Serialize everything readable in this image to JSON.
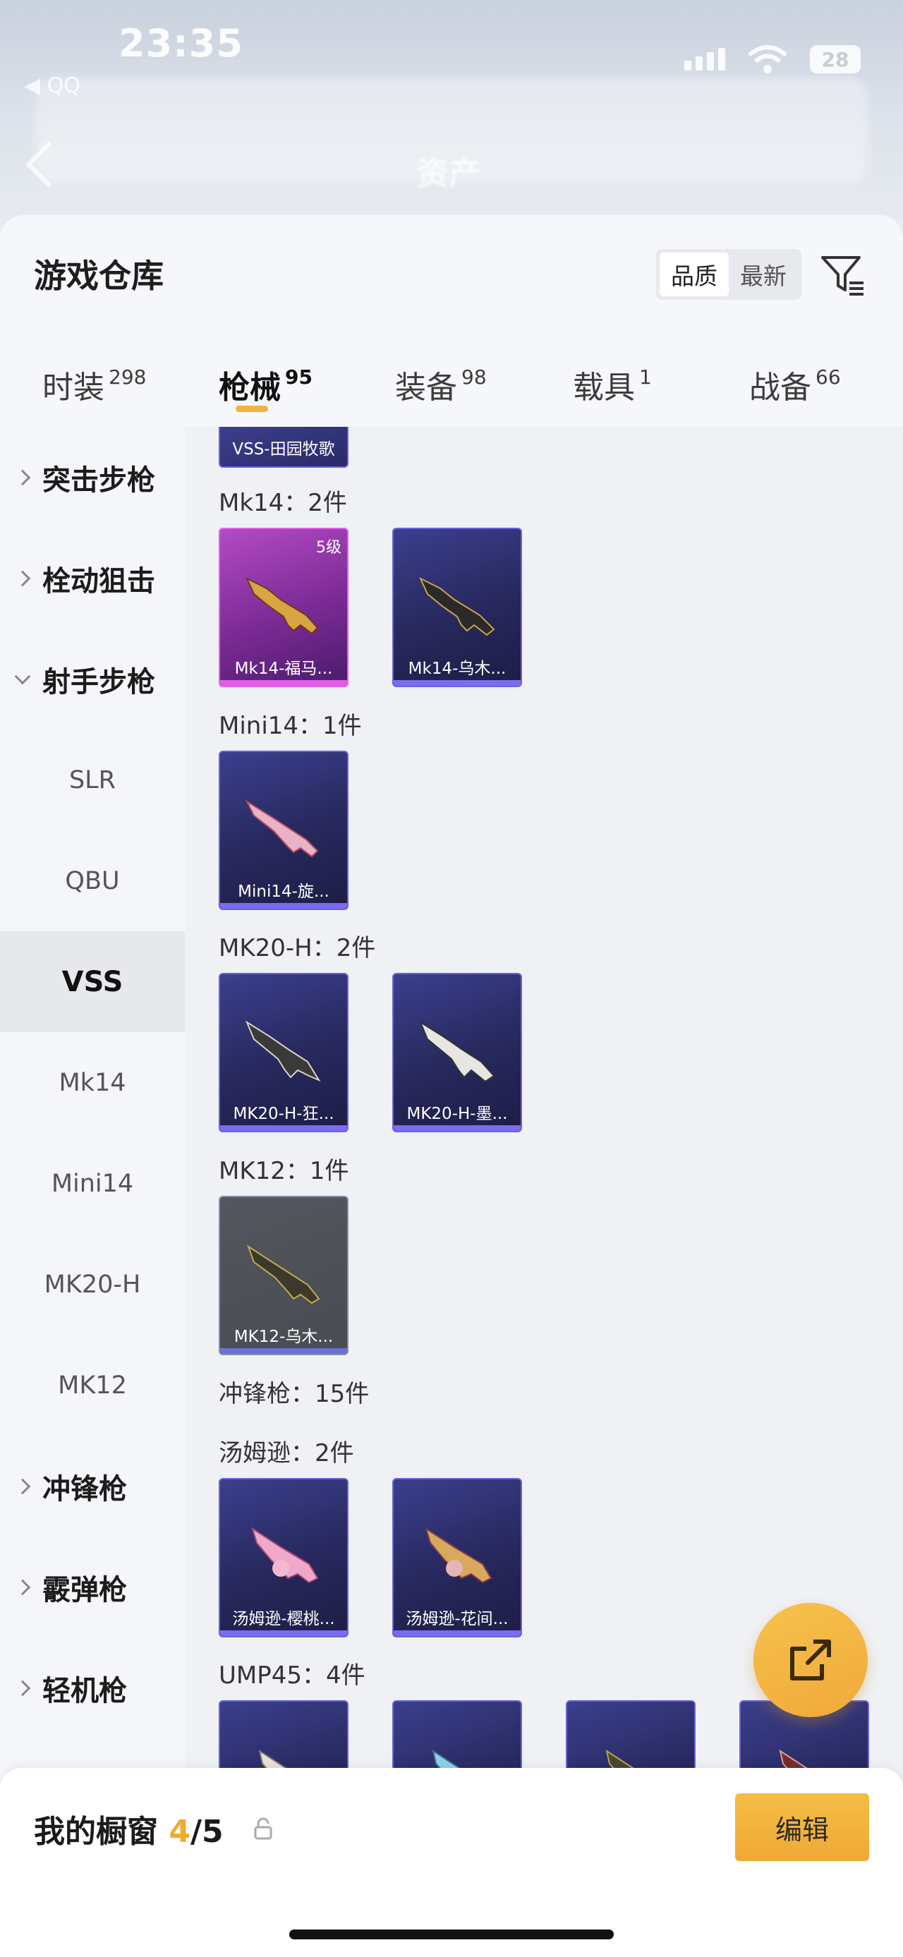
{
  "status": {
    "time": "23:35",
    "battery": "28",
    "back_small": "◀ QQ"
  },
  "header": {
    "blur_title": "资产"
  },
  "warehouse": {
    "title": "游戏仓库",
    "sort_options": [
      "品质",
      "最新"
    ],
    "active_sort": "品质"
  },
  "tabs": [
    {
      "label": "时装",
      "count": "298"
    },
    {
      "label": "枪械",
      "count": "95"
    },
    {
      "label": "装备",
      "count": "98"
    },
    {
      "label": "载具",
      "count": "1"
    },
    {
      "label": "战备",
      "count": "66"
    }
  ],
  "active_tab": "枪械",
  "sidebar": {
    "groups": {
      "assault": "突击步枪",
      "bolt": "栓动狙击",
      "marksman": "射手步枪",
      "smg": "冲锋枪",
      "shotgun": "霰弹枪",
      "lmg": "轻机枪"
    },
    "subs": [
      "SLR",
      "QBU",
      "VSS",
      "Mk14",
      "Mini14",
      "MK20-H",
      "MK12"
    ],
    "active_sub": "VSS"
  },
  "content": {
    "partial_card_label": "VSS-田园牧歌",
    "sections": {
      "mk14": "Mk14：2件",
      "mini14": "Mini14：1件",
      "mk20h": "MK20-H：2件",
      "mk12": "MK12：1件",
      "smg": "冲锋枪：15件",
      "tommy": "汤姆逊：2件",
      "ump45": "UMP45：4件"
    },
    "cards": {
      "mk14_1": {
        "label": "Mk14-福马...",
        "badge": "5级",
        "color": "#e05fe4"
      },
      "mk14_2": {
        "label": "Mk14-乌木..."
      },
      "mini14_1": {
        "label": "Mini14-旋..."
      },
      "mk20h_1": {
        "label": "MK20-H-狂..."
      },
      "mk20h_2": {
        "label": "MK20-H-墨..."
      },
      "mk12_1": {
        "label": "MK12-乌木..."
      },
      "tommy_1": {
        "label": "汤姆逊-樱桃..."
      },
      "tommy_2": {
        "label": "汤姆逊-花间..."
      }
    }
  },
  "showcase": {
    "label": "我的橱窗",
    "current": "4",
    "total": "/5",
    "edit_label": "编辑"
  },
  "colors": {
    "accent": "#f0ad30",
    "card_purple": "#2b2c66",
    "card_pink": "#9a36b0"
  }
}
